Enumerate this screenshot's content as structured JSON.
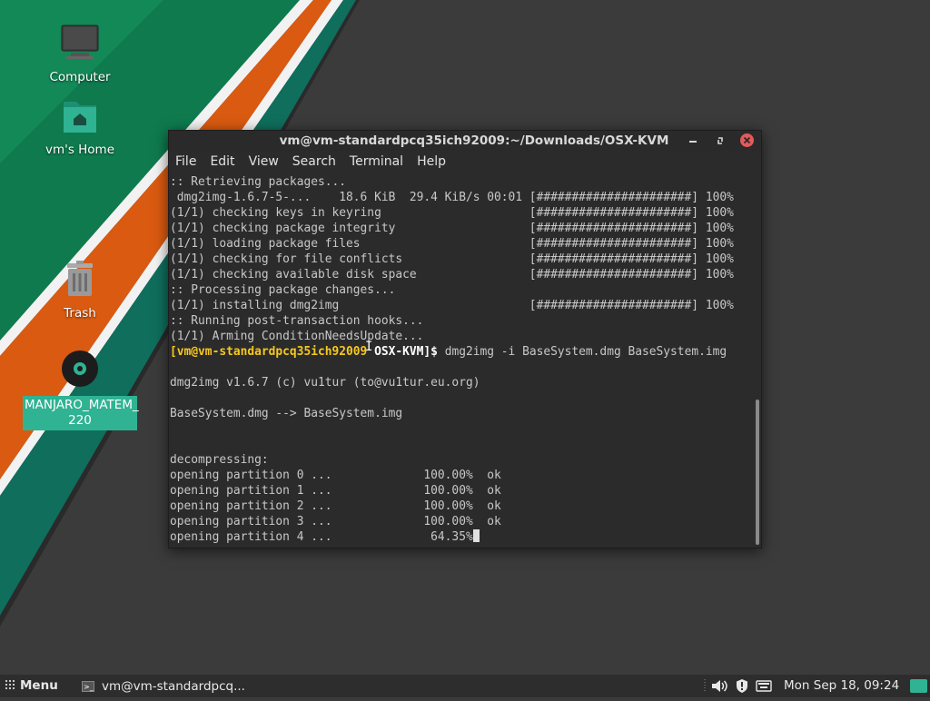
{
  "desktop": {
    "icons": [
      {
        "label": "Computer"
      },
      {
        "label": "vm's Home"
      },
      {
        "label": "Trash"
      },
      {
        "label": "MANJARO_MATEM_\n220"
      }
    ]
  },
  "window": {
    "title": "vm@vm-standardpcq35ich92009:~/Downloads/OSX-KVM",
    "menu": [
      "File",
      "Edit",
      "View",
      "Search",
      "Terminal",
      "Help"
    ]
  },
  "terminal": {
    "lines": [
      ":: Retrieving packages...",
      " dmg2img-1.6.7-5-...    18.6 KiB  29.4 KiB/s 00:01 [######################] 100%",
      "(1/1) checking keys in keyring                     [######################] 100%",
      "(1/1) checking package integrity                   [######################] 100%",
      "(1/1) loading package files                        [######################] 100%",
      "(1/1) checking for file conflicts                  [######################] 100%",
      "(1/1) checking available disk space                [######################] 100%",
      ":: Processing package changes...",
      "(1/1) installing dmg2img                           [######################] 100%",
      ":: Running post-transaction hooks...",
      "(1/1) Arming ConditionNeedsUpdate..."
    ],
    "prompt_user": "[vm@vm-standardpcq35ich92009",
    "prompt_dir": "OSX-KVM]$",
    "command": " dmg2img -i BaseSystem.dmg BaseSystem.img",
    "output": [
      "",
      "dmg2img v1.6.7 (c) vu1tur (to@vu1tur.eu.org)",
      "",
      "BaseSystem.dmg --> BaseSystem.img",
      "",
      "",
      "decompressing:",
      "opening partition 0 ...             100.00%  ok",
      "opening partition 1 ...             100.00%  ok",
      "opening partition 2 ...             100.00%  ok",
      "opening partition 3 ...             100.00%  ok"
    ],
    "last_line": "opening partition 4 ...              64.35%"
  },
  "taskbar": {
    "menu_label": "Menu",
    "task_label": "vm@vm-standardpcq...",
    "clock": "Mon Sep 18, 09:24"
  },
  "colors": {
    "accent": "#2fb393",
    "close": "#e35a5a",
    "prompt": "#f7c81e"
  }
}
